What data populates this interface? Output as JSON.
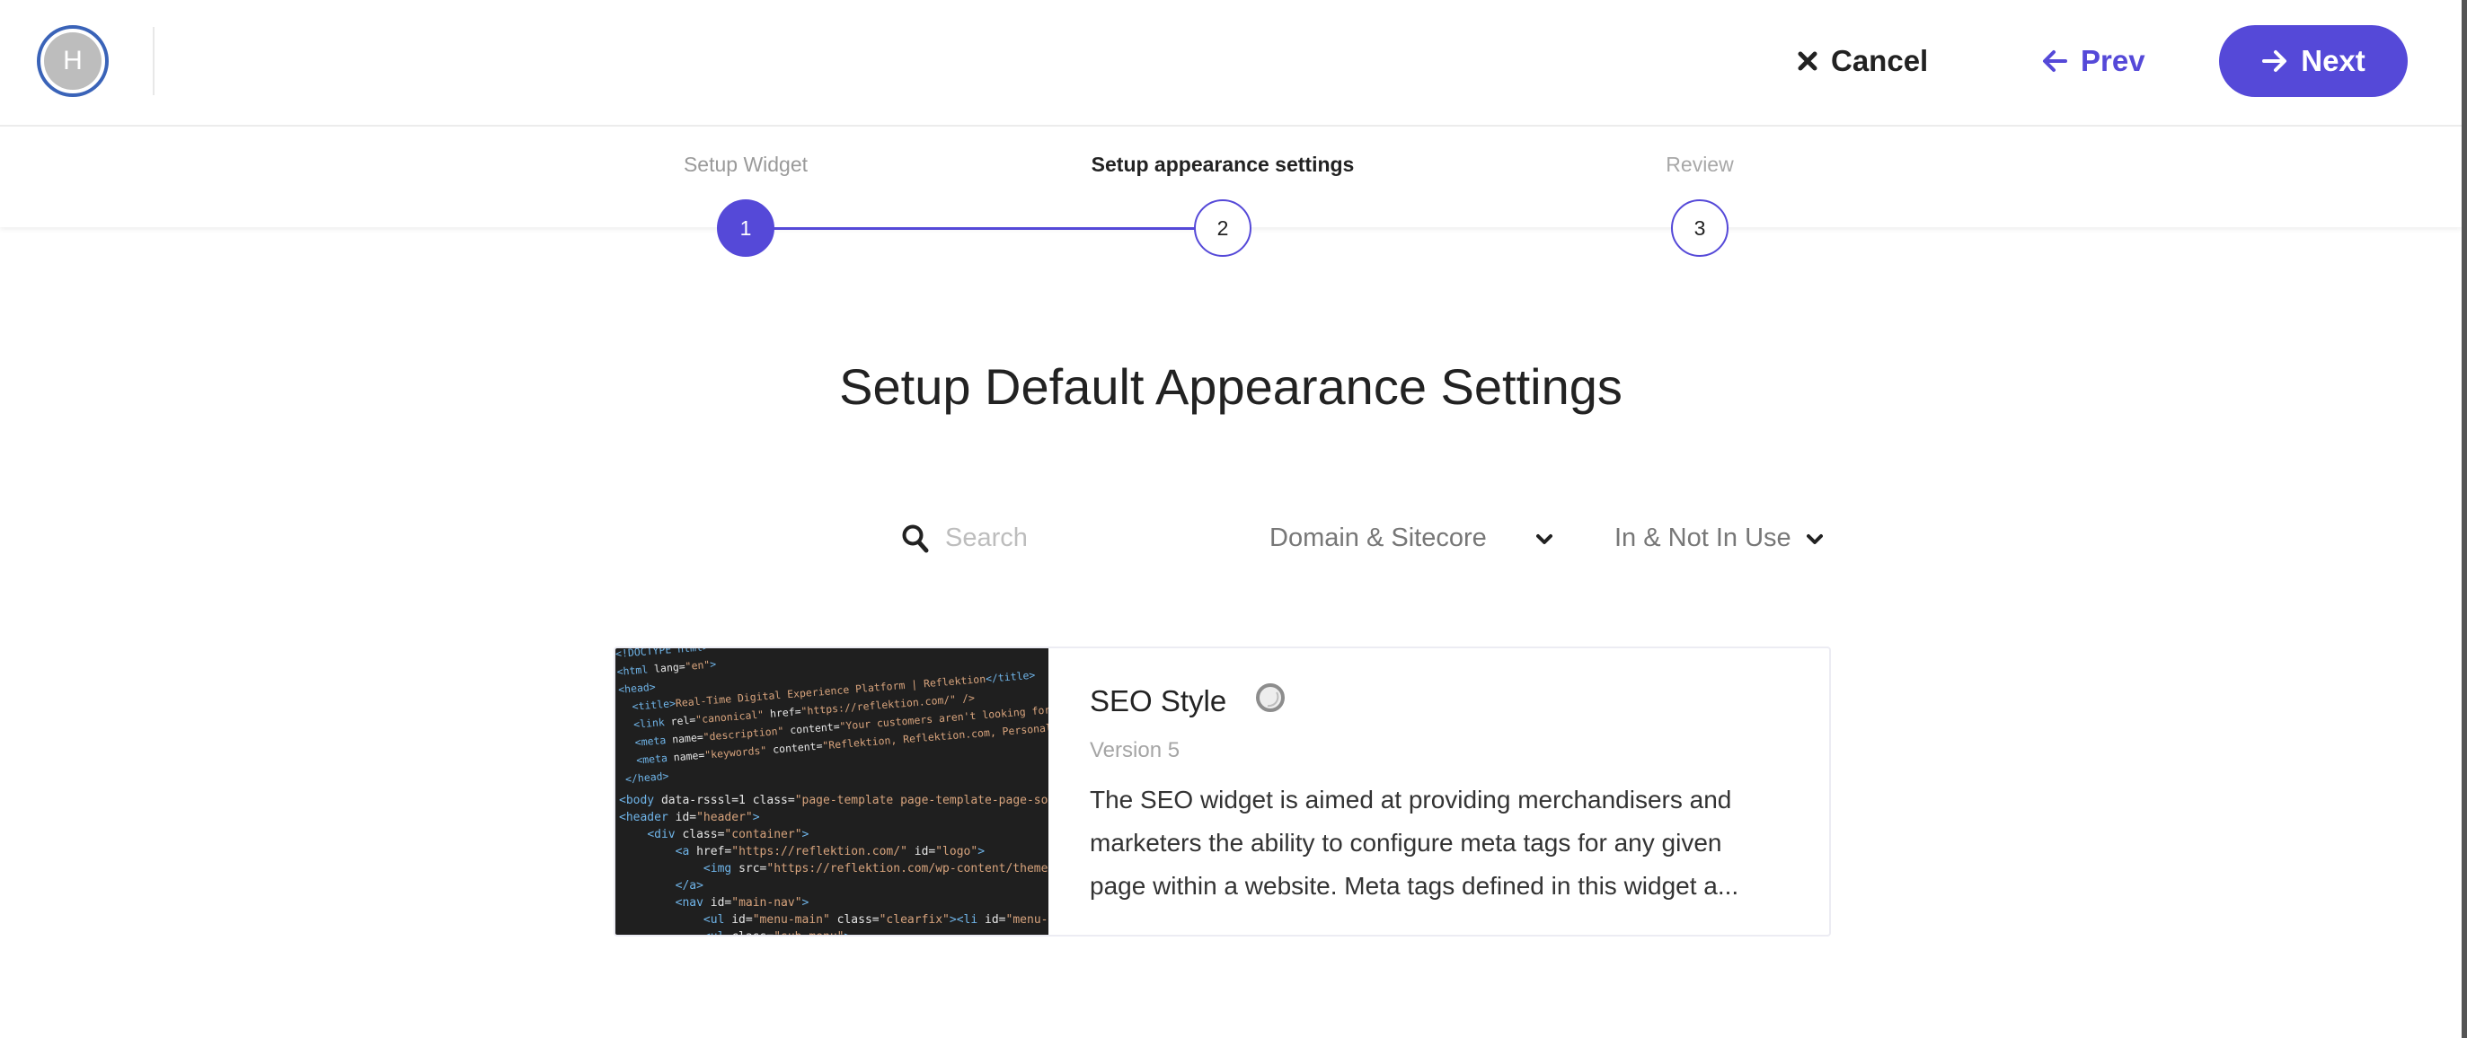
{
  "header": {
    "avatar_initial": "H",
    "cancel_label": "Cancel",
    "prev_label": "Prev",
    "next_label": "Next",
    "accent_color": "#5549d8"
  },
  "stepper": {
    "steps": [
      {
        "label": "Setup Widget",
        "number": "1",
        "state": "completed"
      },
      {
        "label": "Setup appearance settings",
        "number": "2",
        "state": "active"
      },
      {
        "label": "Review",
        "number": "3",
        "state": "upcoming"
      }
    ]
  },
  "main": {
    "title": "Setup Default Appearance Settings",
    "search": {
      "placeholder": "Search",
      "value": ""
    },
    "filters": {
      "domain_selected": "Domain & Sitecore",
      "usage_selected": "In & Not In Use"
    },
    "cards": [
      {
        "title": "SEO Style",
        "status_icon": "loading-spinner-icon",
        "version": "Version 5",
        "description": "The SEO widget is aimed at providing merchandisers and marketers the ability to configure meta tags for any given page within a website. Meta tags defined in this widget a...",
        "thumbnail_alt": "HTML source code screenshot"
      }
    ]
  }
}
